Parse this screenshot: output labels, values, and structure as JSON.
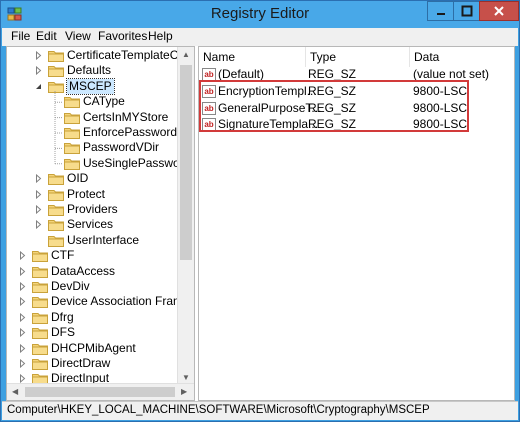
{
  "window": {
    "title": "Registry Editor"
  },
  "menu": [
    "File",
    "Edit",
    "View",
    "Favorites",
    "Help"
  ],
  "tree": [
    {
      "label": "CertificateTemplateCa",
      "level": 2,
      "expander": "collapsed"
    },
    {
      "label": "Defaults",
      "level": 2,
      "expander": "collapsed"
    },
    {
      "label": "MSCEP",
      "level": 2,
      "expander": "expanded",
      "selected": true
    },
    {
      "label": "CAType",
      "level": 3,
      "expander": "none"
    },
    {
      "label": "CertsInMYStore",
      "level": 3,
      "expander": "none"
    },
    {
      "label": "EnforcePassword",
      "level": 3,
      "expander": "none"
    },
    {
      "label": "PasswordVDir",
      "level": 3,
      "expander": "none"
    },
    {
      "label": "UseSinglePassword",
      "level": 3,
      "expander": "none"
    },
    {
      "label": "OID",
      "level": 2,
      "expander": "collapsed"
    },
    {
      "label": "Protect",
      "level": 2,
      "expander": "collapsed"
    },
    {
      "label": "Providers",
      "level": 2,
      "expander": "collapsed"
    },
    {
      "label": "Services",
      "level": 2,
      "expander": "collapsed"
    },
    {
      "label": "UserInterface",
      "level": 2,
      "expander": "none"
    },
    {
      "label": "CTF",
      "level": 1,
      "expander": "collapsed"
    },
    {
      "label": "DataAccess",
      "level": 1,
      "expander": "collapsed"
    },
    {
      "label": "DevDiv",
      "level": 1,
      "expander": "collapsed"
    },
    {
      "label": "Device Association Frame",
      "level": 1,
      "expander": "collapsed"
    },
    {
      "label": "Dfrg",
      "level": 1,
      "expander": "collapsed"
    },
    {
      "label": "DFS",
      "level": 1,
      "expander": "collapsed"
    },
    {
      "label": "DHCPMibAgent",
      "level": 1,
      "expander": "collapsed"
    },
    {
      "label": "DirectDraw",
      "level": 1,
      "expander": "collapsed"
    },
    {
      "label": "DirectInput",
      "level": 1,
      "expander": "collapsed"
    }
  ],
  "columns": {
    "name": "Name",
    "type": "Type",
    "data": "Data"
  },
  "values": [
    {
      "name": "(Default)",
      "type": "REG_SZ",
      "data": "(value not set)"
    },
    {
      "name": "EncryptionTempl...",
      "type": "REG_SZ",
      "data": "9800-LSC"
    },
    {
      "name": "GeneralPurposeT...",
      "type": "REG_SZ",
      "data": "9800-LSC"
    },
    {
      "name": "SignatureTempla...",
      "type": "REG_SZ",
      "data": "9800-LSC"
    }
  ],
  "status": {
    "path": "Computer\\HKEY_LOCAL_MACHINE\\SOFTWARE\\Microsoft\\Cryptography\\MSCEP"
  },
  "colors": {
    "titlebar": "#48a8e8",
    "highlight": "#d23a3a",
    "selection": "#cce8ff"
  },
  "icons": {
    "app": "registry-icon",
    "folder": "folder-icon",
    "value": "string-value-icon"
  }
}
